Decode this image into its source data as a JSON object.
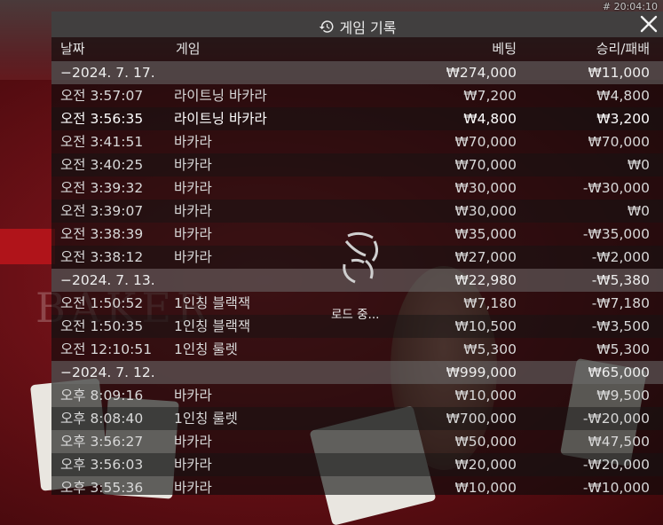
{
  "clock": "# 20:04:10",
  "title": "게임 기록",
  "columns": {
    "date": "날짜",
    "game": "게임",
    "bet": "베팅",
    "result": "승리/패배"
  },
  "loading_text": "로드 중...",
  "groups": [
    {
      "date": "−2024. 7. 17.",
      "bet": "₩274,000",
      "result": "₩11,000",
      "rows": [
        {
          "time": "오전 3:57:07",
          "game": "라이트닝 바카라",
          "bet": "₩7,200",
          "result": "₩4,800"
        },
        {
          "time": "오전 3:56:35",
          "game": "라이트닝 바카라",
          "bet": "₩4,800",
          "result": "₩3,200"
        },
        {
          "time": "오전 3:41:51",
          "game": "바카라",
          "bet": "₩70,000",
          "result": "₩70,000"
        },
        {
          "time": "오전 3:40:25",
          "game": "바카라",
          "bet": "₩70,000",
          "result": "₩0"
        },
        {
          "time": "오전 3:39:32",
          "game": "바카라",
          "bet": "₩30,000",
          "result": "-₩30,000"
        },
        {
          "time": "오전 3:39:07",
          "game": "바카라",
          "bet": "₩30,000",
          "result": "₩0"
        },
        {
          "time": "오전 3:38:39",
          "game": "바카라",
          "bet": "₩35,000",
          "result": "-₩35,000"
        },
        {
          "time": "오전 3:38:12",
          "game": "바카라",
          "bet": "₩27,000",
          "result": "-₩2,000"
        }
      ]
    },
    {
      "date": "−2024. 7. 13.",
      "bet": "₩22,980",
      "result": "-₩5,380",
      "rows": [
        {
          "time": "오전 1:50:52",
          "game": "1인칭 블랙잭",
          "bet": "₩7,180",
          "result": "-₩7,180"
        },
        {
          "time": "오전 1:50:35",
          "game": "1인칭 블랙잭",
          "bet": "₩10,500",
          "result": "-₩3,500"
        },
        {
          "time": "오전 12:10:51",
          "game": "1인칭 룰렛",
          "bet": "₩5,300",
          "result": "₩5,300"
        }
      ]
    },
    {
      "date": "−2024. 7. 12.",
      "bet": "₩999,000",
      "result": "₩65,000",
      "rows": [
        {
          "time": "오후 8:09:16",
          "game": "바카라",
          "bet": "₩10,000",
          "result": "₩9,500"
        },
        {
          "time": "오후 8:08:40",
          "game": "1인칭 룰렛",
          "bet": "₩700,000",
          "result": "-₩20,000"
        },
        {
          "time": "오후 3:56:27",
          "game": "바카라",
          "bet": "₩50,000",
          "result": "₩47,500"
        },
        {
          "time": "오후 3:56:03",
          "game": "바카라",
          "bet": "₩20,000",
          "result": "-₩20,000"
        },
        {
          "time": "오후 3:55:36",
          "game": "바카라",
          "bet": "₩10,000",
          "result": "-₩10,000"
        }
      ]
    }
  ]
}
